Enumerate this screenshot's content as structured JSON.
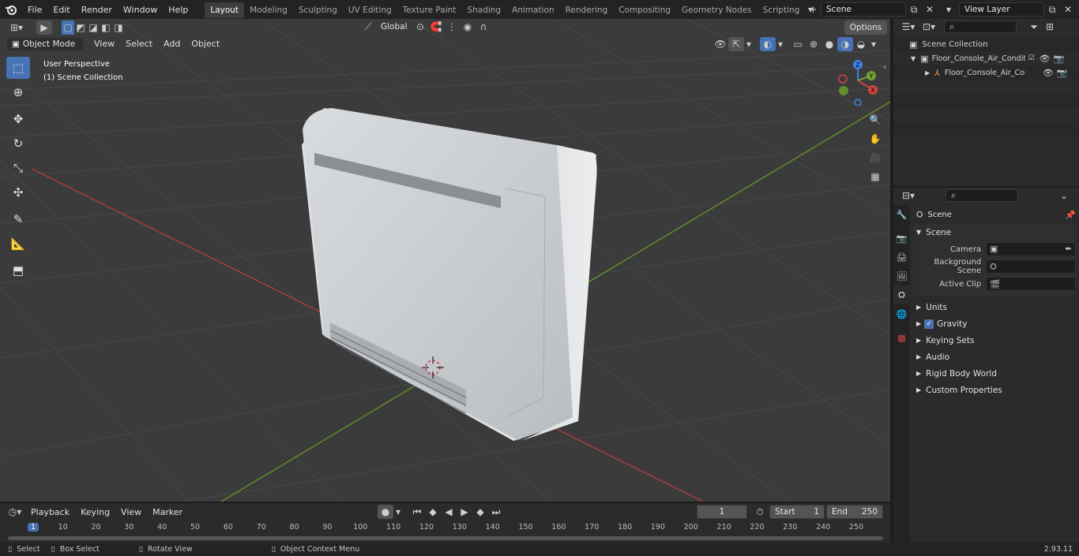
{
  "topbar": {
    "menus": [
      "File",
      "Edit",
      "Render",
      "Window",
      "Help"
    ],
    "workspaces": [
      "Layout",
      "Modeling",
      "Sculpting",
      "UV Editing",
      "Texture Paint",
      "Shading",
      "Animation",
      "Rendering",
      "Compositing",
      "Geometry Nodes",
      "Scripting"
    ],
    "active_workspace": "Layout",
    "add_workspace": "+",
    "scene_name": "Scene",
    "view_layer": "View Layer"
  },
  "viewport": {
    "mode": "Object Mode",
    "menus": [
      "View",
      "Select",
      "Add",
      "Object"
    ],
    "transform_orientation": "Global",
    "options_label": "Options",
    "overlay_title": "User Perspective",
    "overlay_subtitle": "(1) Scene Collection",
    "gizmo_axes": {
      "x": "X",
      "y": "Y",
      "z": "Z"
    },
    "colors": {
      "x_axis": "#d0453f",
      "y_axis": "#6ea32f",
      "z_axis": "#3a81e8",
      "grid_bg": "#3b3b3b",
      "active_tool": "#4772b3"
    }
  },
  "outliner": {
    "root": "Scene Collection",
    "collection": "Floor_Console_Air_Conditione",
    "object": "Floor_Console_Air_Condi"
  },
  "properties": {
    "breadcrumb": "Scene",
    "section": "Scene",
    "fields": [
      {
        "label": "Camera",
        "value": ""
      },
      {
        "label": "Background Scene",
        "value": ""
      },
      {
        "label": "Active Clip",
        "value": ""
      }
    ],
    "panels": [
      "Units",
      "Gravity",
      "Keying Sets",
      "Audio",
      "Rigid Body World",
      "Custom Properties"
    ],
    "gravity_checked": true
  },
  "timeline": {
    "menus": [
      "Playback",
      "Keying",
      "View",
      "Marker"
    ],
    "current_frame": "1",
    "start_label": "Start",
    "start": "1",
    "end_label": "End",
    "end": "250",
    "ruler": [
      "1",
      "10",
      "20",
      "30",
      "40",
      "50",
      "60",
      "70",
      "80",
      "90",
      "100",
      "110",
      "120",
      "130",
      "140",
      "150",
      "160",
      "170",
      "180",
      "190",
      "200",
      "210",
      "220",
      "230",
      "240",
      "250"
    ]
  },
  "statusbar": {
    "select": "Select",
    "box_select": "Box Select",
    "rotate_view": "Rotate View",
    "context_menu": "Object Context Menu",
    "version": "2.93.11"
  }
}
